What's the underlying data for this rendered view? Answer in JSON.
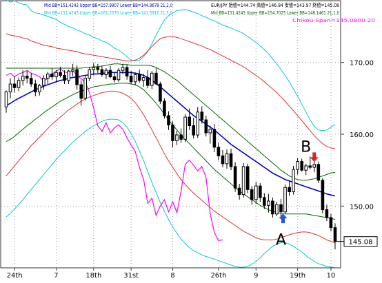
{
  "chart_data": {
    "type": "candlestick",
    "legend_lines": [
      {
        "text": "Mid BB=151.4243 Upper BB=157.9807 Lower BB=144.8678  21,2,0",
        "color": "#0000cc"
      },
      {
        "text": "Mid BB=151.4243 Upper BB=161.2570 Lower BB=141.5916  21,3,0",
        "color": "#00cccc"
      },
      {
        "text": "EUR/JPY 始値=144.74 高値=146.84 安値=143.97 終値=145.08",
        "color": "#000000"
      },
      {
        "text": "Mid BB=151.4243 Upper BB=154.7025 Lower BB=148.1461  21,1,0",
        "color": "#006600"
      },
      {
        "text": "Chikou Span=145.0800  20",
        "color": "#ff00ff"
      }
    ],
    "y_ticks": [
      {
        "label": "170.00",
        "value": 170
      },
      {
        "label": "160.00",
        "value": 160
      },
      {
        "label": "150.00",
        "value": 150
      }
    ],
    "ylim": [
      141.5,
      178.5
    ],
    "last_price": {
      "label": "145.08",
      "value": 145.08
    },
    "x_tick_labels": [
      {
        "label": "24th",
        "bar": 2
      },
      {
        "label": "7",
        "bar": 12
      },
      {
        "label": "18th",
        "bar": 21
      },
      {
        "label": "31st",
        "bar": 30
      },
      {
        "label": "8",
        "bar": 40
      },
      {
        "label": "26th",
        "bar": 51
      },
      {
        "label": "9",
        "bar": 60
      },
      {
        "label": "19th",
        "bar": 70
      },
      {
        "label": "10",
        "bar": 78
      }
    ],
    "candles": [
      [
        163.8,
        166.1,
        163.0,
        165.9
      ],
      [
        165.9,
        167.8,
        165.0,
        167.0
      ],
      [
        167.0,
        168.1,
        165.8,
        166.5
      ],
      [
        166.5,
        167.9,
        166.0,
        167.5
      ],
      [
        167.5,
        168.9,
        166.8,
        168.1
      ],
      [
        168.1,
        168.8,
        167.1,
        167.8
      ],
      [
        167.8,
        168.5,
        166.6,
        167.0
      ],
      [
        167.0,
        167.6,
        165.3,
        165.9
      ],
      [
        165.9,
        167.0,
        165.4,
        166.8
      ],
      [
        166.8,
        168.2,
        166.2,
        167.8
      ],
      [
        167.8,
        168.7,
        167.0,
        168.4
      ],
      [
        168.4,
        169.2,
        167.6,
        168.0
      ],
      [
        168.0,
        168.9,
        167.2,
        168.6
      ],
      [
        168.6,
        169.4,
        167.9,
        168.2
      ],
      [
        168.2,
        168.9,
        167.0,
        167.5
      ],
      [
        167.5,
        169.0,
        167.0,
        168.8
      ],
      [
        168.8,
        169.8,
        168.1,
        169.0
      ],
      [
        169.0,
        169.6,
        166.2,
        166.9
      ],
      [
        166.9,
        167.5,
        164.0,
        165.0
      ],
      [
        165.0,
        168.1,
        164.7,
        167.8
      ],
      [
        167.8,
        169.4,
        167.4,
        169.0
      ],
      [
        169.0,
        169.9,
        168.2,
        169.3
      ],
      [
        169.3,
        169.8,
        168.5,
        169.0
      ],
      [
        169.0,
        169.5,
        168.0,
        168.3
      ],
      [
        168.3,
        169.2,
        167.7,
        168.9
      ],
      [
        168.9,
        169.5,
        167.8,
        168.0
      ],
      [
        168.0,
        168.6,
        167.2,
        167.6
      ],
      [
        167.6,
        169.2,
        167.3,
        168.9
      ],
      [
        168.9,
        169.8,
        168.4,
        169.3
      ],
      [
        169.3,
        169.7,
        167.6,
        168.1
      ],
      [
        168.1,
        168.8,
        167.0,
        167.3
      ],
      [
        167.3,
        168.6,
        166.8,
        168.3
      ],
      [
        168.3,
        169.0,
        167.2,
        167.5
      ],
      [
        167.5,
        168.4,
        166.6,
        167.9
      ],
      [
        167.9,
        168.9,
        166.4,
        166.8
      ],
      [
        166.8,
        168.8,
        166.3,
        168.5
      ],
      [
        168.5,
        169.2,
        166.8,
        167.0
      ],
      [
        167.0,
        167.3,
        164.2,
        164.6
      ],
      [
        164.6,
        165.0,
        162.2,
        162.6
      ],
      [
        162.6,
        163.2,
        160.6,
        161.3
      ],
      [
        161.3,
        161.8,
        158.2,
        159.1
      ],
      [
        159.1,
        160.5,
        158.5,
        159.9
      ],
      [
        159.9,
        160.8,
        158.8,
        159.3
      ],
      [
        159.3,
        162.8,
        158.9,
        162.4
      ],
      [
        162.4,
        163.6,
        160.6,
        161.2
      ],
      [
        161.2,
        162.3,
        159.4,
        159.9
      ],
      [
        159.9,
        163.8,
        159.5,
        163.1
      ],
      [
        163.1,
        163.9,
        161.5,
        162.0
      ],
      [
        162.0,
        162.6,
        159.7,
        160.2
      ],
      [
        160.2,
        161.2,
        158.7,
        160.7
      ],
      [
        160.7,
        161.4,
        157.5,
        158.2
      ],
      [
        158.2,
        158.8,
        156.4,
        157.0
      ],
      [
        157.0,
        157.8,
        155.4,
        155.9
      ],
      [
        155.9,
        157.9,
        155.2,
        157.3
      ],
      [
        157.3,
        158.0,
        155.0,
        155.5
      ],
      [
        155.5,
        156.1,
        152.0,
        152.5
      ],
      [
        152.5,
        153.1,
        150.9,
        151.6
      ],
      [
        151.6,
        156.0,
        151.2,
        155.5
      ],
      [
        155.5,
        155.9,
        151.8,
        152.3
      ],
      [
        152.3,
        152.8,
        150.2,
        150.9
      ],
      [
        150.9,
        153.4,
        150.3,
        152.8
      ],
      [
        152.8,
        153.2,
        150.6,
        151.2
      ],
      [
        151.2,
        151.8,
        149.6,
        150.1
      ],
      [
        150.1,
        151.7,
        149.1,
        150.7
      ],
      [
        150.7,
        151.2,
        148.4,
        148.9
      ],
      [
        148.9,
        150.6,
        148.6,
        150.2
      ],
      [
        150.2,
        151.0,
        148.2,
        149.2
      ],
      [
        149.2,
        153.0,
        148.9,
        152.6
      ],
      [
        152.6,
        153.5,
        151.4,
        152.0
      ],
      [
        152.0,
        155.6,
        151.6,
        155.1
      ],
      [
        155.1,
        156.7,
        154.4,
        156.2
      ],
      [
        156.2,
        156.6,
        154.8,
        155.0
      ],
      [
        155.0,
        155.9,
        154.3,
        155.6
      ],
      [
        155.6,
        156.9,
        155.1,
        155.4
      ],
      [
        155.4,
        156.3,
        154.7,
        155.8
      ],
      [
        155.8,
        156.2,
        153.2,
        153.6
      ],
      [
        153.6,
        153.9,
        149.0,
        149.5
      ],
      [
        149.5,
        150.2,
        147.9,
        148.4
      ],
      [
        148.4,
        148.9,
        146.5,
        147.0
      ],
      [
        147.0,
        147.6,
        143.97,
        145.08
      ]
    ],
    "bollinger": [
      {
        "name": "Upper BB 21,3,0",
        "color": "#00cccc",
        "values": [
          178.7,
          178.4,
          178.6,
          178.3,
          178.1,
          178.0,
          177.2,
          176.9,
          176.8,
          176.6,
          176.4,
          176.2,
          176.0,
          175.6,
          175.3,
          175.0,
          174.8,
          174.5,
          174.3,
          174.0,
          173.8,
          173.5,
          173.3,
          173.0,
          172.8,
          172.4,
          172.0,
          171.7,
          171.3,
          170.8,
          170.3,
          170.2,
          170.3,
          170.8,
          171.5,
          172.6,
          173.8,
          174.9,
          175.9,
          176.5,
          176.9,
          177.2,
          177.3,
          177.4,
          177.2,
          177.0,
          176.8,
          176.5,
          176.3,
          176.0,
          175.8,
          175.5,
          175.2,
          175.0,
          174.8,
          174.5,
          174.3,
          174.0,
          173.6,
          173.2,
          172.8,
          172.3,
          171.8,
          171.2,
          170.5,
          169.8,
          169.0,
          168.2,
          167.3,
          166.3,
          165.3,
          164.2,
          163.1,
          162.0,
          161.1,
          160.6,
          160.5,
          160.6,
          161.0,
          161.4
        ]
      },
      {
        "name": "Upper BB 21,2,0",
        "color": "#e03030",
        "values": [
          174.0,
          173.8,
          173.7,
          173.6,
          173.4,
          173.3,
          173.0,
          172.8,
          172.6,
          172.4,
          172.3,
          172.2,
          172.0,
          171.9,
          171.8,
          171.7,
          171.6,
          171.5,
          171.3,
          171.2,
          171.1,
          171.0,
          170.9,
          170.8,
          170.7,
          170.6,
          170.5,
          170.4,
          170.3,
          170.2,
          170.2,
          170.3,
          170.6,
          171.0,
          171.6,
          172.2,
          172.8,
          173.3,
          173.5,
          173.6,
          173.6,
          173.5,
          173.3,
          173.1,
          172.9,
          172.7,
          172.5,
          172.3,
          172.0,
          171.8,
          171.5,
          171.2,
          170.9,
          170.6,
          170.3,
          170.0,
          169.7,
          169.4,
          169.0,
          168.6,
          168.2,
          167.8,
          167.3,
          166.8,
          166.3,
          165.8,
          165.2,
          164.6,
          163.9,
          163.3,
          162.6,
          161.9,
          161.2,
          160.5,
          159.8,
          159.2,
          158.7,
          158.3,
          158.1,
          157.98
        ]
      },
      {
        "name": "Upper BB 21,1,0",
        "color": "#006600",
        "values": [
          169.2,
          169.2,
          169.2,
          169.2,
          169.2,
          169.2,
          169.2,
          169.2,
          169.2,
          169.2,
          169.2,
          169.2,
          169.2,
          169.2,
          169.2,
          169.2,
          169.2,
          169.2,
          169.2,
          169.3,
          169.3,
          169.4,
          169.4,
          169.5,
          169.6,
          169.7,
          169.8,
          169.8,
          169.7,
          169.7,
          169.6,
          169.6,
          169.6,
          169.6,
          169.6,
          169.5,
          169.3,
          169.0,
          168.7,
          168.3,
          167.9,
          167.5,
          167.0,
          166.5,
          166.0,
          165.5,
          165.0,
          164.5,
          164.0,
          163.5,
          163.0,
          162.5,
          162.0,
          161.5,
          161.0,
          160.5,
          160.0,
          159.5,
          159.0,
          158.5,
          158.0,
          157.5,
          157.0,
          156.5,
          156.0,
          155.5,
          155.0,
          154.6,
          154.2,
          153.9,
          153.7,
          153.6,
          153.6,
          153.7,
          153.8,
          154.0,
          154.2,
          154.4,
          154.6,
          154.7
        ]
      },
      {
        "name": "Mid BB",
        "color": "#0000cc",
        "values": [
          164.0,
          164.3,
          164.7,
          165.0,
          165.3,
          165.6,
          165.9,
          166.2,
          166.4,
          166.7,
          166.9,
          167.1,
          167.3,
          167.5,
          167.6,
          167.8,
          167.9,
          168.0,
          168.1,
          168.2,
          168.3,
          168.4,
          168.4,
          168.5,
          168.5,
          168.6,
          168.6,
          168.6,
          168.6,
          168.6,
          168.6,
          168.5,
          168.4,
          168.2,
          167.9,
          167.5,
          167.1,
          166.6,
          166.1,
          165.6,
          165.1,
          164.6,
          164.1,
          163.6,
          163.1,
          162.6,
          162.2,
          161.8,
          161.4,
          161.0,
          160.6,
          160.1,
          159.6,
          159.1,
          158.6,
          158.2,
          157.8,
          157.4,
          157.0,
          156.6,
          156.2,
          155.8,
          155.4,
          155.0,
          154.6,
          154.3,
          154.0,
          153.7,
          153.5,
          153.3,
          153.1,
          152.9,
          152.7,
          152.5,
          152.3,
          152.1,
          151.9,
          151.7,
          151.55,
          151.42
        ]
      },
      {
        "name": "Lower BB 21,1,0",
        "color": "#006600",
        "values": [
          159.0,
          159.3,
          159.7,
          160.2,
          160.7,
          161.2,
          161.6,
          162.1,
          162.5,
          163.0,
          163.4,
          163.8,
          164.2,
          164.6,
          164.9,
          165.2,
          165.5,
          165.8,
          166.0,
          166.2,
          166.4,
          166.6,
          166.7,
          166.8,
          166.9,
          167.0,
          167.0,
          167.1,
          167.1,
          167.1,
          167.0,
          166.9,
          166.6,
          166.2,
          165.6,
          165.0,
          164.3,
          163.6,
          162.8,
          162.0,
          161.3,
          160.6,
          159.9,
          159.3,
          158.7,
          158.1,
          157.5,
          156.9,
          156.3,
          155.7,
          155.1,
          154.6,
          154.1,
          153.6,
          153.1,
          152.6,
          152.1,
          151.7,
          151.3,
          150.9,
          150.5,
          150.1,
          149.8,
          149.5,
          149.3,
          149.1,
          149.0,
          148.9,
          148.9,
          148.9,
          148.9,
          148.9,
          148.9,
          148.8,
          148.7,
          148.6,
          148.5,
          148.4,
          148.3,
          148.15
        ]
      },
      {
        "name": "Lower BB 21,2,0",
        "color": "#e03030",
        "values": [
          154.2,
          154.9,
          155.6,
          156.3,
          157.0,
          157.7,
          158.4,
          159.0,
          159.6,
          160.2,
          160.8,
          161.4,
          161.9,
          162.4,
          162.9,
          163.4,
          163.8,
          164.2,
          164.6,
          164.9,
          165.2,
          165.4,
          165.6,
          165.8,
          165.9,
          166.0,
          166.0,
          165.9,
          165.7,
          165.4,
          165.0,
          164.4,
          163.6,
          162.7,
          161.7,
          160.6,
          159.5,
          158.4,
          157.3,
          156.3,
          155.4,
          154.5,
          153.7,
          153.0,
          152.4,
          151.8,
          151.3,
          150.8,
          150.3,
          149.8,
          149.3,
          148.9,
          148.5,
          148.1,
          147.7,
          147.3,
          146.9,
          146.5,
          146.2,
          145.9,
          145.6,
          145.4,
          145.3,
          145.3,
          145.3,
          145.4,
          145.6,
          145.8,
          146.0,
          146.2,
          146.3,
          146.4,
          146.4,
          146.3,
          146.1,
          145.9,
          145.6,
          145.3,
          145.1,
          144.87
        ]
      },
      {
        "name": "Lower BB 21,3,0",
        "color": "#00cccc",
        "values": [
          148.5,
          149.0,
          149.6,
          150.2,
          150.9,
          151.6,
          152.3,
          153.0,
          153.7,
          154.4,
          155.1,
          155.8,
          156.5,
          157.1,
          157.7,
          158.3,
          158.9,
          159.4,
          159.9,
          160.4,
          160.8,
          161.2,
          161.5,
          161.8,
          162.0,
          162.1,
          162.1,
          162.0,
          161.6,
          161.0,
          160.1,
          159.0,
          157.7,
          156.3,
          154.8,
          153.3,
          151.9,
          150.5,
          149.3,
          148.1,
          147.1,
          146.2,
          145.4,
          144.8,
          144.2,
          143.8,
          143.5,
          143.2,
          143.0,
          142.8,
          142.6,
          142.4,
          142.2,
          142.0,
          141.8,
          141.6,
          141.5,
          141.5,
          141.6,
          141.9,
          142.3,
          142.8,
          143.4,
          143.9,
          144.4,
          144.7,
          144.9,
          144.9,
          144.7,
          144.4,
          144.0,
          143.6,
          143.1,
          142.7,
          142.3,
          142.0,
          141.8,
          141.6,
          141.5,
          141.45
        ]
      }
    ],
    "chikou_span": {
      "name": "Chikou Span",
      "color": "#ff00ff",
      "values": [
        168.2,
        168.5,
        168.0,
        168.4,
        168.6,
        168.9,
        168.5,
        168.3,
        168.0,
        167.4,
        167.8,
        168.4,
        168.8,
        169.1,
        168.7,
        168.5,
        168.9,
        168.2,
        167.7,
        167.3,
        165.8,
        163.6,
        161.2,
        160.4,
        161.6,
        160.2,
        160.9,
        161.3,
        160.7,
        159.5,
        158.5,
        157.6,
        155.4,
        153.7,
        150.4,
        151.1,
        148.7,
        150.0,
        150.9,
        149.2,
        150.6,
        149.1,
        152.1,
        155.8,
        156.4,
        155.7,
        154.9,
        155.5,
        154.0,
        148.9,
        146.3,
        145.2,
        145.3
      ]
    },
    "annotations": [
      {
        "text": "A",
        "bar": 66,
        "value": 145.4
      },
      {
        "text": "B",
        "bar": 72,
        "value": 158.3
      }
    ],
    "markers": [
      {
        "kind": "up-arrow",
        "color": "#2255dd",
        "bar": 66.5,
        "value": 148.2
      },
      {
        "kind": "down-arrow",
        "color": "#dd2222",
        "bar": 74,
        "value": 156.9
      }
    ],
    "grid": true,
    "grid_style": "dotted"
  }
}
